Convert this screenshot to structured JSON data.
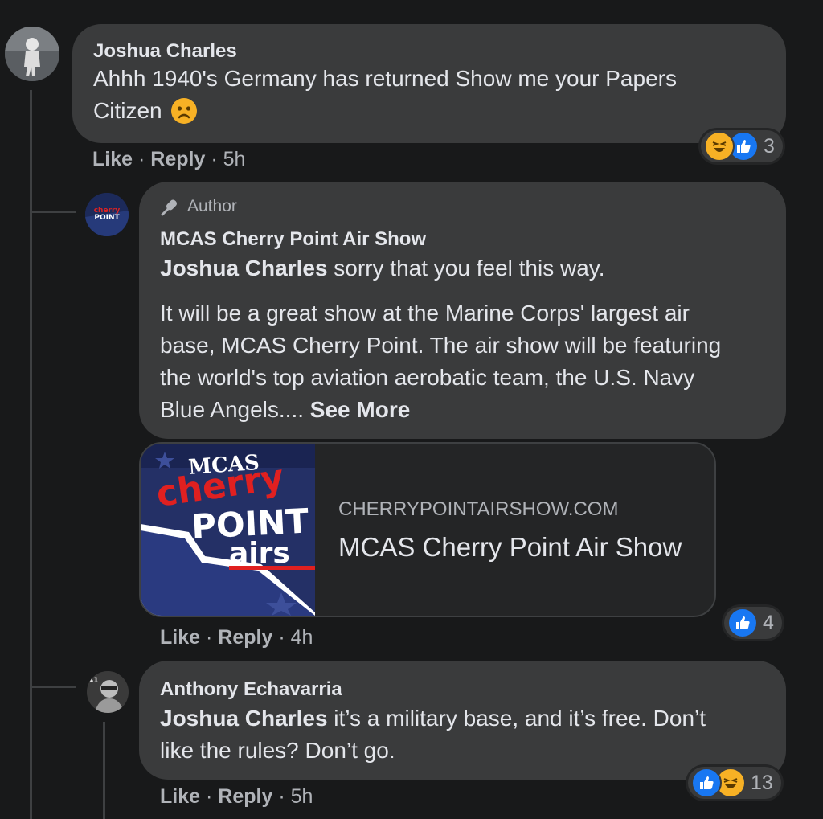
{
  "comments": [
    {
      "author": "Joshua Charles",
      "line1": "Ahhh 1940's Germany has returned Show me your Papers",
      "line2": "Citizen",
      "actions": {
        "like": "Like",
        "reply": "Reply",
        "time": "5h",
        "sep": "·"
      },
      "reactions": {
        "icons": [
          "haha",
          "like"
        ],
        "count": "3"
      }
    },
    {
      "badge": "Author",
      "author": "MCAS Cherry Point Air Show",
      "mention": "Joshua Charles",
      "text_after_mention": " sorry that you feel this way.",
      "para2": [
        "It will be a great show at the Marine Corps' largest air",
        "base, MCAS Cherry Point. The air show will be featuring",
        "the world's top aviation aerobatic team, the U.S. Navy"
      ],
      "para2_last": "Blue Angels....",
      "see_more": "See More",
      "link_preview": {
        "domain": "CHERRYPOINTAIRSHOW.COM",
        "title": "MCAS Cherry Point Air Show",
        "logo_text": {
          "top": "MCAS",
          "mid": "cherry",
          "low": "POINT",
          "bottom": "airs"
        }
      },
      "actions": {
        "like": "Like",
        "reply": "Reply",
        "time": "4h",
        "sep": "·"
      },
      "reactions": {
        "icons": [
          "like"
        ],
        "count": "4"
      },
      "avatar_text": "POINT"
    },
    {
      "author": "Anthony Echavarria",
      "mention": "Joshua Charles",
      "text_after_mention": " it’s a military base, and it’s free. Don’t",
      "line2": "like the rules? Don’t go.",
      "actions": {
        "like": "Like",
        "reply": "Reply",
        "time": "5h",
        "sep": "·"
      },
      "reactions": {
        "icons": [
          "like",
          "haha"
        ],
        "count": "13"
      }
    }
  ],
  "colors": {
    "background": "#18191a",
    "bubble": "#3a3b3c",
    "like_blue": "#1877f2",
    "haha_yellow": "#f7b125"
  }
}
